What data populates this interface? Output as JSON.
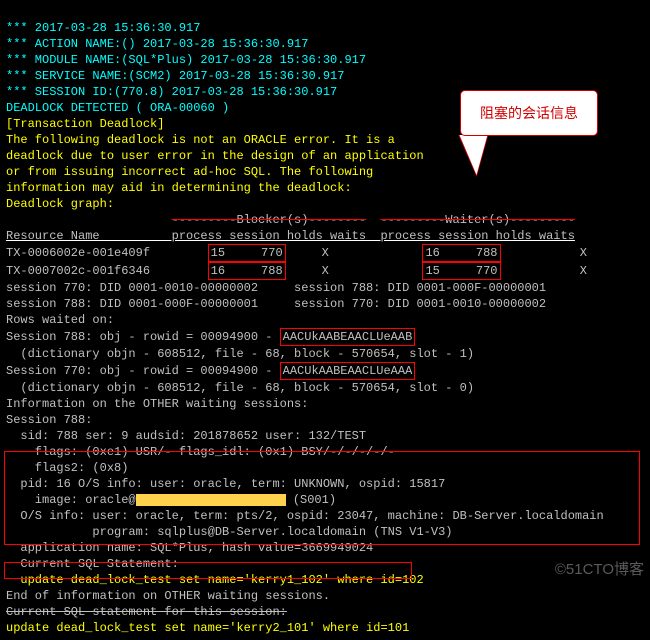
{
  "header": {
    "ts_line": "*** 2017-03-28 15:36:30.917",
    "action": "*** ACTION NAME:() 2017-03-28 15:36:30.917",
    "module": "*** MODULE NAME:(SQL*Plus) 2017-03-28 15:36:30.917",
    "service": "*** SERVICE NAME:(SCM2) 2017-03-28 15:36:30.917",
    "session": "*** SESSION ID:(770.8) 2017-03-28 15:36:30.917",
    "deadlock": "DEADLOCK DETECTED ( ORA-00060 )",
    "txn": "[Transaction Deadlock]",
    "msg1": "The following deadlock is not an ORACLE error. It is a",
    "msg2": "deadlock due to user error in the design of an application",
    "msg3": "or from issuing incorrect ad-hoc SQL. The following",
    "msg4": "information may aid in determining the deadlock:",
    "graph": "Deadlock graph:"
  },
  "table": {
    "sep_blocker": "---------Blocker(s)--------",
    "sep_waiter": "---------Waiter(s)---------",
    "cols": "Resource Name          process session holds waits  process session holds waits",
    "row1_name": "TX-0006002e-001e409f",
    "row1_b": "15     770",
    "row1_b2": "     X             ",
    "row1_w": "16     788",
    "row1_w2": "           X",
    "row2_name": "TX-0007002c-001f6346",
    "row2_b": "16     788",
    "row2_b2": "     X             ",
    "row2_w": "15     770",
    "row2_w2": "           X"
  },
  "did": {
    "l1": "session 770: DID 0001-0010-00000002\tsession 788: DID 0001-000F-00000001",
    "l2": "session 788: DID 0001-000F-00000001\tsession 770: DID 0001-0010-00000002"
  },
  "rows": {
    "hdr": "Rows waited on:",
    "s788a": "Session 788: obj - rowid = 00094900 - ",
    "s788rid": "AACUkAABEAACLUeAAB",
    "s788b": "  (dictionary objn - 608512, file - 68, block - 570654, slot - 1)",
    "s770a": "Session 770: obj - rowid = 00094900 - ",
    "s770rid": "AACUkAABEAACLUeAAA",
    "s770b": "  (dictionary objn - 608512, file - 68, block - 570654, slot - 0)"
  },
  "info": {
    "hdr": "Information on the OTHER waiting sessions:",
    "sess": "Session 788:",
    "sid": "  sid: 788 ser: 9 audsid: 201878652 user: 132/TEST",
    "flags1": "    flags: (0xe1) USR/- flags_idl: (0x1) BSY/-/-/-/-/-",
    "flags2": "    flags2: (0x8)",
    "pid": "  pid: 16 O/S info: user: oracle, term: UNKNOWN, ospid: 15817",
    "image_pre": "    image: oracle@",
    "image_post": " (S001)",
    "os": "  O/S info: user: oracle, term: pts/2, ospid: 23047, machine: DB-Server.localdomain",
    "prog": "            program: sqlplus@DB-Server.localdomain (TNS V1-V3)",
    "app": "  application name: SQL*Plus, hash value=3669949024",
    "cur": "  Current SQL Statement:",
    "sql1": "  update dead_lock_test set name='kerry1_102' where id=102"
  },
  "tail": {
    "end": "End of information on OTHER waiting sessions.",
    "cur": "Current SQL statement for this session:",
    "sql2": "update dead_lock_test set name='kerry2_101' where id=101"
  },
  "callout": "阻塞的会话信息",
  "watermark": "©51CTO博客",
  "chart_data": {
    "type": "table",
    "title": "Deadlock graph",
    "columns": [
      "Resource Name",
      "Blocker process",
      "Blocker session",
      "Blocker holds",
      "Blocker waits",
      "Waiter process",
      "Waiter session",
      "Waiter holds",
      "Waiter waits"
    ],
    "rows": [
      [
        "TX-0006002e-001e409f",
        15,
        770,
        "X",
        "",
        16,
        788,
        "",
        "X"
      ],
      [
        "TX-0007002c-001f6346",
        16,
        788,
        "X",
        "",
        15,
        770,
        "",
        "X"
      ]
    ]
  }
}
